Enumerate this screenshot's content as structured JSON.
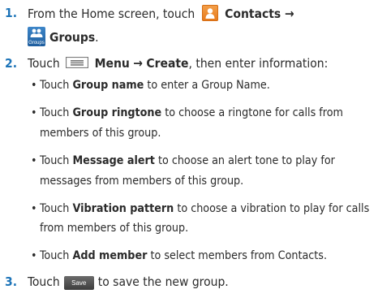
{
  "steps": [
    {
      "num": "1.",
      "intro": "From the Home screen, touch",
      "contacts": "Contacts →",
      "groups": "Groups",
      "groups_icon_caption": "Groups",
      "end": "."
    },
    {
      "num": "2.",
      "intro": "Touch",
      "menu": "Menu",
      "arrow": "→",
      "create": "Create",
      "rest": ", then enter information:"
    },
    {
      "num": "3.",
      "intro": "Touch",
      "save_button": "Save",
      "rest": "to save the new group."
    }
  ],
  "bullets": [
    {
      "pre": "Touch ",
      "bold": "Group name",
      "post": " to enter a Group Name."
    },
    {
      "pre": "Touch ",
      "bold": "Group ringtone",
      "post": " to choose a ringtone for calls from"
    },
    {
      "cont": "members of this group."
    },
    {
      "pre": "Touch ",
      "bold": "Message alert",
      "post": " to choose an alert tone to play for"
    },
    {
      "cont": "messages from members of this group."
    },
    {
      "pre": "Touch ",
      "bold": "Vibration pattern",
      "post": " to choose a vibration to play for calls"
    },
    {
      "cont": "from members of this group."
    },
    {
      "pre": "Touch ",
      "bold": "Add member",
      "post": " to select members from Contacts."
    }
  ],
  "bullet_char": "•",
  "icons": {
    "contacts": "contacts-app-icon",
    "groups": "groups-icon",
    "menu": "menu-key-icon"
  },
  "colors": {
    "step_number": "#1d74b8",
    "contacts_icon": "#e67a1c",
    "groups_icon": "#2a6db0",
    "save_button": "#4a4a4a"
  }
}
